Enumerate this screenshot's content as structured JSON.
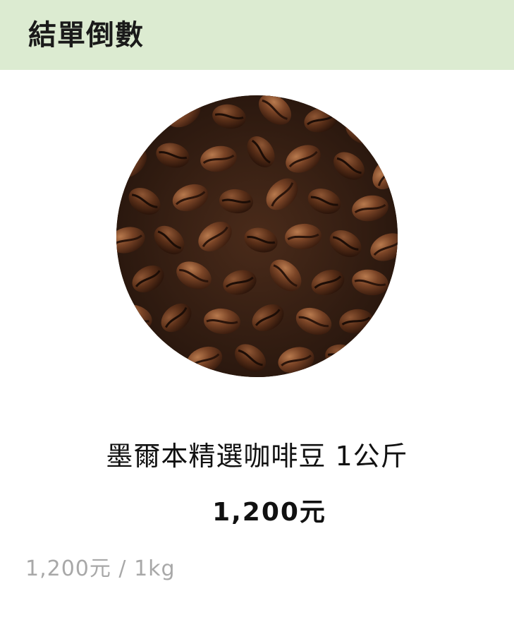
{
  "header": {
    "title": "結單倒數",
    "background": "#dcebd1"
  },
  "product": {
    "image_icon": "coffee-beans-photo",
    "name": "墨爾本精選咖啡豆 1公斤",
    "price": "1,200元",
    "unit_price": "1,200元 / 1kg"
  }
}
